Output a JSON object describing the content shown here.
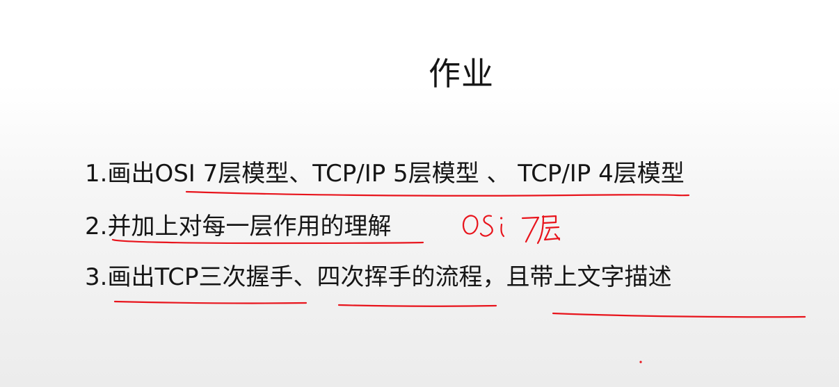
{
  "slide": {
    "title": "作业",
    "items": [
      {
        "label": "1.画出OSI 7层模型、TCP/IP 5层模型 、 TCP/IP 4层模型"
      },
      {
        "label": "2.并加上对每一层作用的理解"
      },
      {
        "label": "3.画出TCP三次握手、四次挥手的流程，且带上文字描述"
      }
    ],
    "handwritten_note": "OSi 7层",
    "ink_color": "#e8141c"
  }
}
